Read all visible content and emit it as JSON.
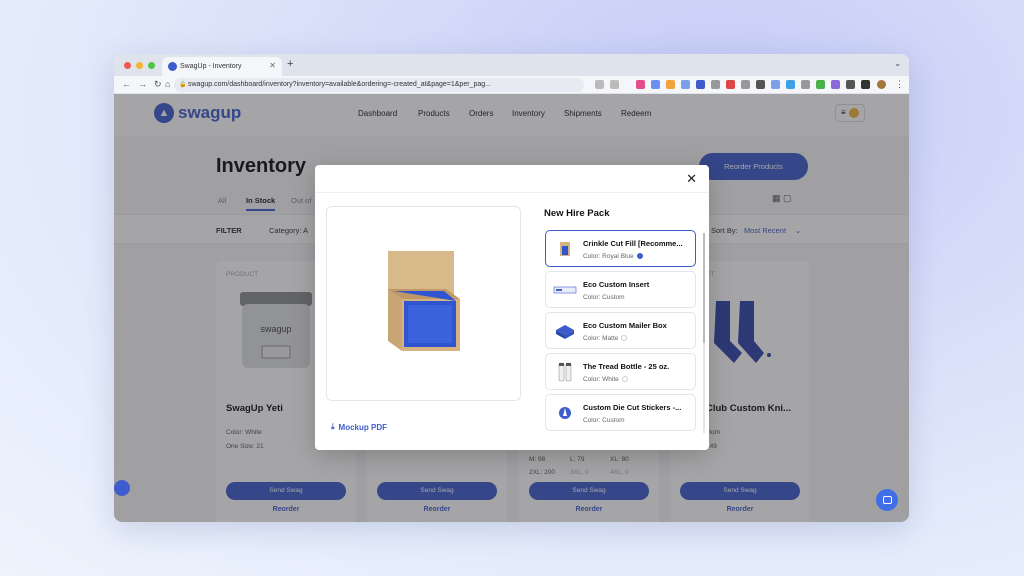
{
  "browser": {
    "tab_title": "SwagUp - Inventory",
    "url": "swagup.com/dashboard/inventory?inventory=available&ordering=-created_at&page=1&per_pag..."
  },
  "nav": {
    "logo": "swagup",
    "links": [
      "Dashboard",
      "Products",
      "Orders",
      "Inventory",
      "Shipments",
      "Redeem"
    ]
  },
  "page": {
    "title": "Inventory",
    "reorder_button": "Reorder Products",
    "tabs": [
      "All",
      "In Stock",
      "Out of"
    ],
    "filter_label": "FILTER",
    "category_label": "Category: A",
    "sort_label": "Sort By:",
    "sort_value": "Most Recent"
  },
  "cards": [
    {
      "label": "PRODUCT",
      "name": "SwagUp Yeti",
      "color": "Color: White",
      "size": "One Size: 21",
      "send": "Send Swag",
      "reorder": "Reorder"
    },
    {
      "send": "Send Swag",
      "reorder": "Reorder"
    },
    {
      "sizes": [
        "M: 98",
        "L: 79",
        "XL: 80",
        "2XL: 200",
        "3XL: 0",
        "4XL: 0"
      ],
      "send": "Send Swag",
      "reorder": "Reorder"
    },
    {
      "label": "CT",
      "name": "Club Custom Kni...",
      "color": "stom",
      "size": "149",
      "send": "Send Swag",
      "reorder": "Reorder"
    }
  ],
  "modal": {
    "pack_title": "New Hire Pack",
    "mockup_pdf": "Mockup PDF",
    "items": [
      {
        "name": "Crinkle Cut Fill [Recomme...",
        "color": "Color: Royal Blue",
        "swatch": "#3f5ccc",
        "selected": true,
        "icon": "crinkle-fill-thumb"
      },
      {
        "name": "Eco Custom Insert",
        "color": "Color: Custom",
        "selected": false,
        "icon": "insert-thumb"
      },
      {
        "name": "Eco Custom Mailer Box",
        "color": "Color: Matte",
        "swatch": "#ffffff",
        "selected": false,
        "icon": "mailer-box-thumb"
      },
      {
        "name": "The Tread Bottle - 25 oz.",
        "color": "Color: White",
        "swatch": "#ffffff",
        "selected": false,
        "icon": "bottle-thumb"
      },
      {
        "name": "Custom Die Cut Stickers -...",
        "color": "Color: Custom",
        "selected": false,
        "icon": "sticker-thumb"
      }
    ]
  },
  "colors": {
    "accent": "#3f5ccc",
    "overlay": "rgba(40,40,45,0.42)"
  }
}
